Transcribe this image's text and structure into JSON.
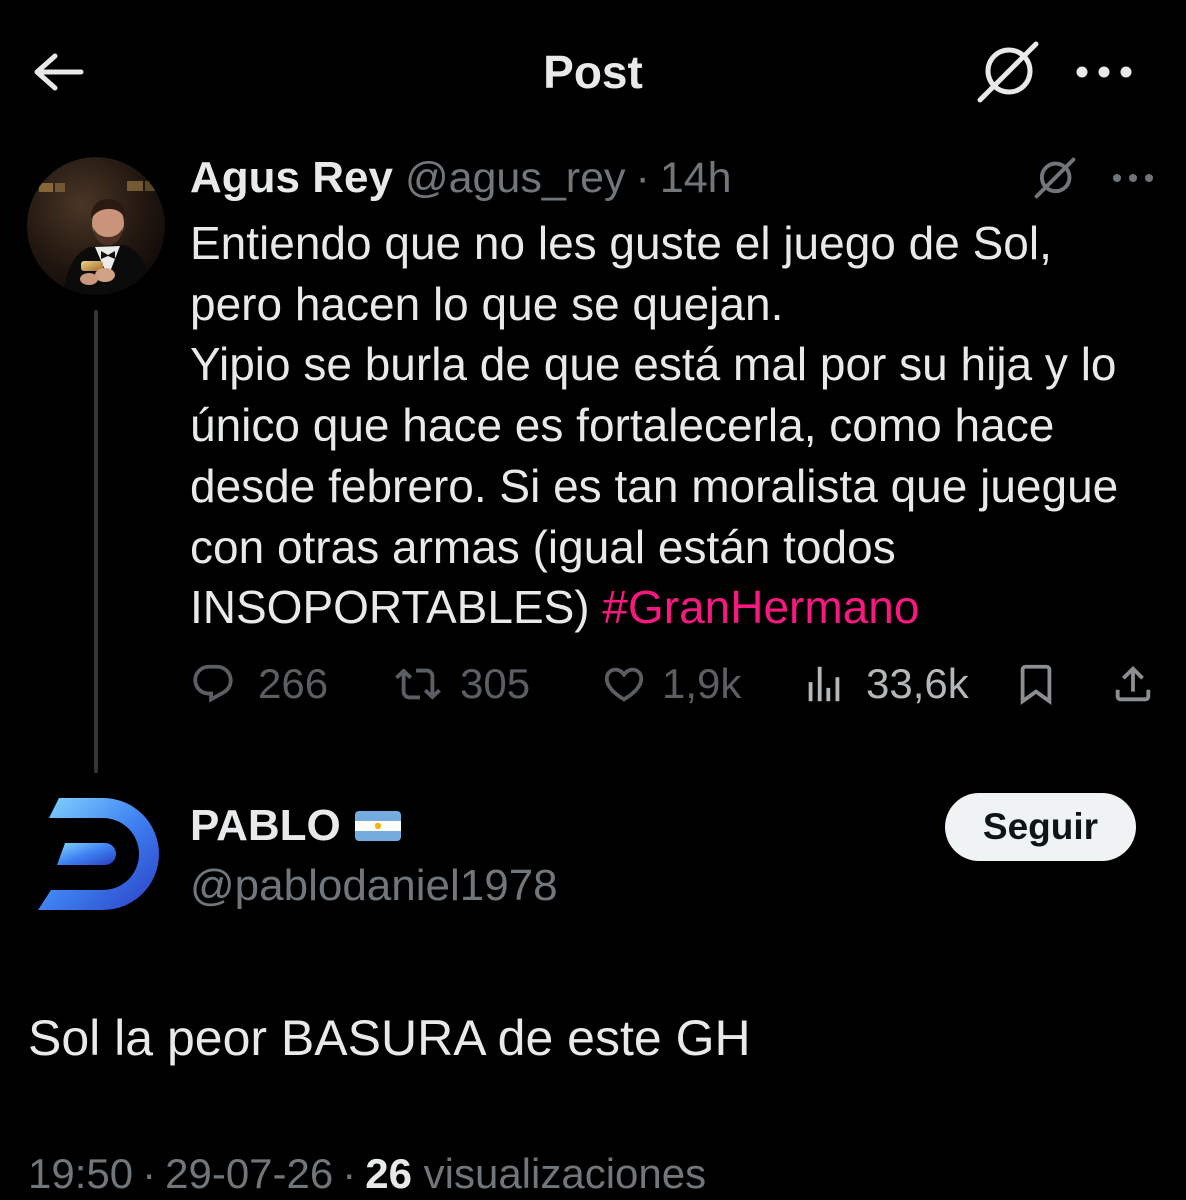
{
  "header": {
    "title": "Post",
    "back_icon": "back-arrow-icon",
    "grok_icon": "grok-icon",
    "more_icon": "more-dots-icon"
  },
  "parent": {
    "name": "Agus Rey",
    "handle": "@agus_rey",
    "separator": "·",
    "time": "14h",
    "text_lines": [
      "Entiendo que no les guste el juego de Sol,",
      "pero hacen lo que se quejan.",
      "Yipio se burla de que está mal por su hija y lo",
      "único que hace es fortalecerla, como hace",
      "desde febrero. Si es tan moralista que juegue",
      "con otras armas (igual están todos"
    ],
    "last_line_text": "INSOPORTABLES)",
    "hashtag": "#GranHermano",
    "stats": {
      "replies": "266",
      "reposts": "305",
      "likes": "1,9k",
      "views": "33,6k"
    },
    "action_icons": [
      "reply-icon",
      "repost-icon",
      "like-icon",
      "views-icon",
      "bookmark-icon",
      "share-icon"
    ]
  },
  "reply": {
    "name": "PABLO",
    "flag_icon": "argentina-flag-icon",
    "handle": "@pablodaniel1978",
    "follow_label": "Seguir",
    "text": "Sol la peor BASURA de este GH",
    "time": "19:50",
    "separator": "·",
    "date": "29-07-26",
    "views_count": "26",
    "views_label": "visualizaciones"
  },
  "colors": {
    "background": "#000000",
    "text": "#e7e9ea",
    "secondary_text": "#71767b",
    "accent": "#f91880",
    "thread_line": "#333639",
    "follow_button_bg": "#eff3f4",
    "follow_button_text": "#0f1419",
    "action_muted": "#5b5f63",
    "views": "#b4b7ba"
  }
}
